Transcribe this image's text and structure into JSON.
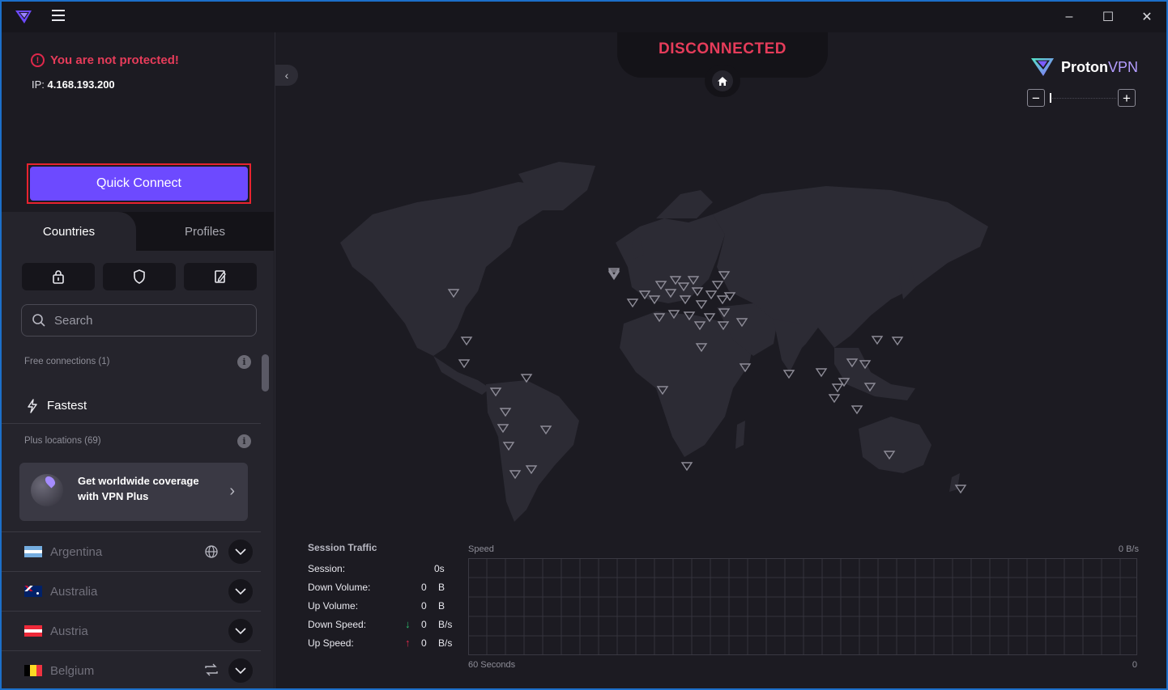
{
  "window": {
    "minimize": "–",
    "maximize": "☐",
    "close": "✕"
  },
  "status": {
    "warning": "You are not protected!",
    "ip_label": "IP:",
    "ip_value": "4.168.193.200",
    "connection_state": "DISCONNECTED"
  },
  "quick_connect_label": "Quick Connect",
  "tabs": [
    {
      "label": "Countries",
      "active": true
    },
    {
      "label": "Profiles",
      "active": false
    }
  ],
  "filters": [
    {
      "icon": "lock-icon"
    },
    {
      "icon": "shield-icon"
    },
    {
      "icon": "edit-icon"
    }
  ],
  "search": {
    "placeholder": "Search",
    "value": ""
  },
  "free_section": {
    "label": "Free connections (1)"
  },
  "fastest_label": "Fastest",
  "plus_section": {
    "label": "Plus locations (69)"
  },
  "promo": {
    "line1": "Get worldwide coverage",
    "line2": "with VPN Plus"
  },
  "countries": [
    {
      "name": "Argentina",
      "icon": "globe-icon"
    },
    {
      "name": "Australia",
      "icon": ""
    },
    {
      "name": "Austria",
      "icon": ""
    },
    {
      "name": "Belgium",
      "icon": "repeat-icon"
    }
  ],
  "brand": {
    "name_bold": "Proton",
    "name_light": "VPN"
  },
  "traffic": {
    "title": "Session Traffic",
    "session_label": "Session:",
    "session_value": "0s",
    "down_volume_label": "Down Volume:",
    "down_volume_value": "0",
    "down_volume_unit": "B",
    "up_volume_label": "Up Volume:",
    "up_volume_value": "0",
    "up_volume_unit": "B",
    "down_speed_label": "Down Speed:",
    "down_speed_value": "0",
    "down_speed_unit": "B/s",
    "up_speed_label": "Up Speed:",
    "up_speed_value": "0",
    "up_speed_unit": "B/s"
  },
  "speed_graph": {
    "title": "Speed",
    "max_label": "0 B/s",
    "time_label": "60 Seconds",
    "zero_label": "0"
  },
  "colors": {
    "accent": "#6d4aff",
    "danger": "#e63c5a",
    "download": "#2dbd6e",
    "upload": "#e0284b"
  }
}
